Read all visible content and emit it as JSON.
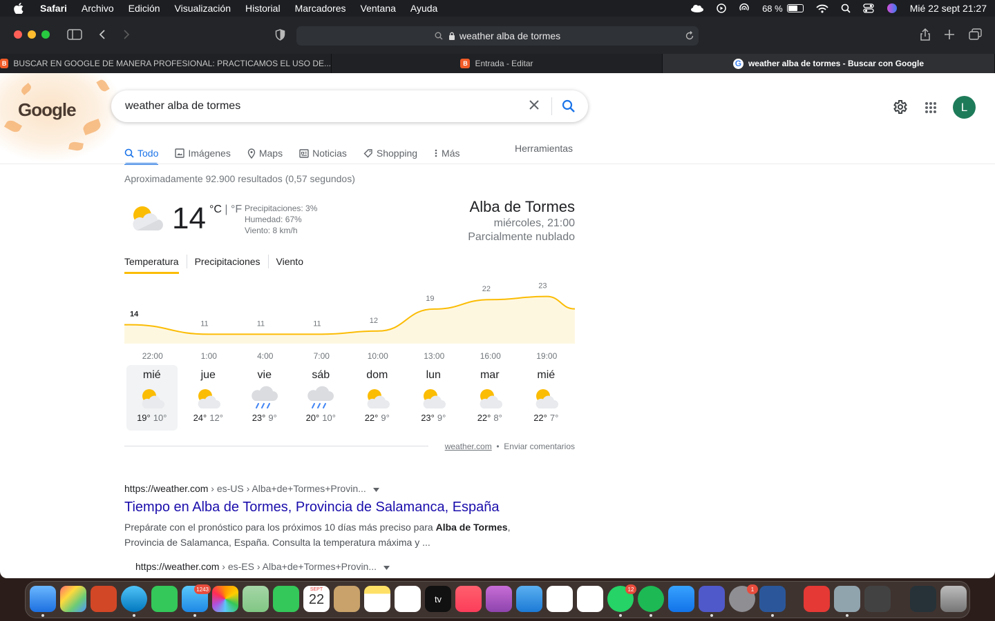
{
  "menubar": {
    "app": "Safari",
    "items": [
      "Archivo",
      "Edición",
      "Visualización",
      "Historial",
      "Marcadores",
      "Ventana",
      "Ayuda"
    ],
    "battery": "68 %",
    "datetime": "Mié 22 sept  21:27"
  },
  "browser": {
    "url": "weather alba de tormes",
    "tabs": [
      {
        "label": "BUSCAR EN GOOGLE DE MANERA PROFESIONAL: PRACTICAMOS EL USO DE..."
      },
      {
        "label": "Entrada - Editar"
      },
      {
        "label": "weather alba de tormes - Buscar con Google"
      }
    ]
  },
  "google": {
    "logo": "Google",
    "query": "weather alba de tormes",
    "avatar_letter": "L",
    "nav": [
      "Todo",
      "Imágenes",
      "Maps",
      "Noticias",
      "Shopping",
      "Más"
    ],
    "tools": "Herramientas",
    "stats": "Aproximadamente 92.900 resultados (0,57 segundos)"
  },
  "weather": {
    "temp": "14",
    "unit_c": "°C",
    "unit_sep": " | ",
    "unit_f": "°F",
    "precip": "Precipitaciones: 3%",
    "humidity": "Humedad: 67%",
    "wind": "Viento: 8 km/h",
    "city": "Alba de Tormes",
    "time": "miércoles, 21:00",
    "condition": "Parcialmente nublado",
    "tabs": [
      "Temperatura",
      "Precipitaciones",
      "Viento"
    ],
    "days": [
      {
        "name": "mié",
        "hi": "19°",
        "lo": "10°",
        "icon": "partly-cloudy"
      },
      {
        "name": "jue",
        "hi": "24°",
        "lo": "12°",
        "icon": "partly-cloudy"
      },
      {
        "name": "vie",
        "hi": "23°",
        "lo": "9°",
        "icon": "rain"
      },
      {
        "name": "sáb",
        "hi": "20°",
        "lo": "10°",
        "icon": "rain"
      },
      {
        "name": "dom",
        "hi": "22°",
        "lo": "9°",
        "icon": "partly-cloudy"
      },
      {
        "name": "lun",
        "hi": "23°",
        "lo": "9°",
        "icon": "partly-cloudy"
      },
      {
        "name": "mar",
        "hi": "22°",
        "lo": "8°",
        "icon": "partly-cloudy"
      },
      {
        "name": "mié",
        "hi": "22°",
        "lo": "7°",
        "icon": "partly-cloudy"
      }
    ],
    "source": "weather.com",
    "feedback": "Enviar comentarios"
  },
  "chart_data": {
    "type": "area",
    "x": [
      "22:00",
      "1:00",
      "4:00",
      "7:00",
      "10:00",
      "13:00",
      "16:00",
      "19:00"
    ],
    "values": [
      14,
      11,
      11,
      11,
      12,
      19,
      22,
      23
    ],
    "ylabel": "",
    "xlabel": "",
    "color": "#fbbc04",
    "fill": "#fef7e0"
  },
  "results": [
    {
      "site": "https://weather.com",
      "path": " › es-US › Alba+de+Tormes+Provin...",
      "title": "Tiempo en Alba de Tormes, Provincia de Salamanca, España",
      "snippet_pre": "Prepárate con el pronóstico para los próximos 10 días más preciso para ",
      "snippet_bold": "Alba de Tormes",
      "snippet_post": ", Provincia de Salamanca, España. Consulta la temperatura máxima y ..."
    },
    {
      "site": "https://weather.com",
      "path": " › es-ES › Alba+de+Tormes+Provin..."
    }
  ],
  "dock": {
    "badges": {
      "mail": "1243",
      "whatsapp": "12",
      "settings": "1"
    },
    "calendar_month": "SEPT",
    "calendar_day": "22",
    "tv_label": "tv"
  }
}
